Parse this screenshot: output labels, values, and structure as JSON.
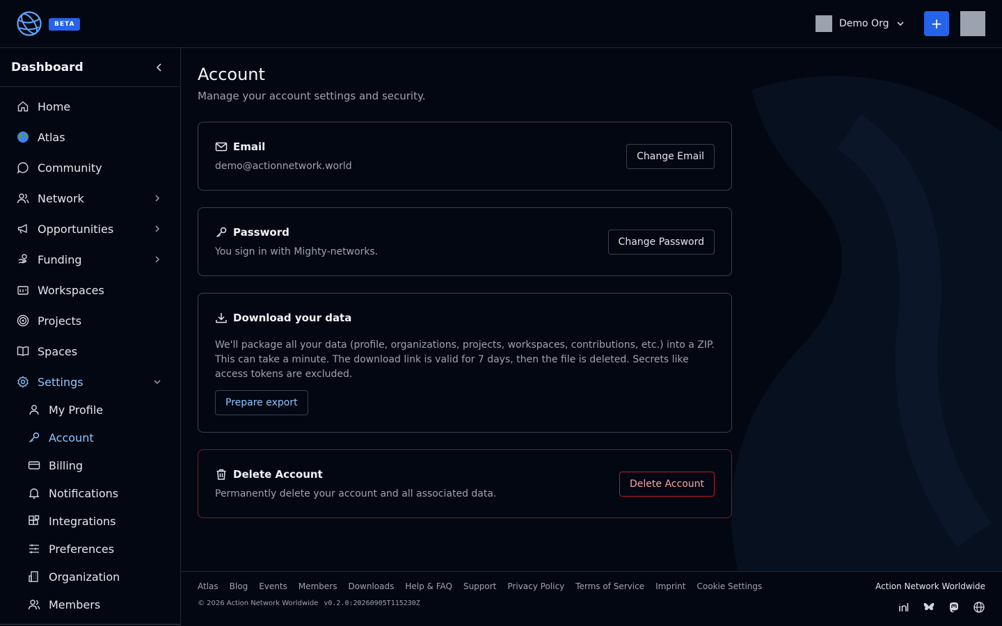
{
  "topbar": {
    "badge": "BETA",
    "org_name": "Demo Org",
    "add_label": "+"
  },
  "sidebar": {
    "title": "Dashboard",
    "items": [
      {
        "label": "Home",
        "icon": "home-icon"
      },
      {
        "label": "Atlas",
        "icon": "globe-icon"
      },
      {
        "label": "Community",
        "icon": "chat-bubble-icon"
      },
      {
        "label": "Network",
        "icon": "users-icon"
      },
      {
        "label": "Opportunities",
        "icon": "megaphone-icon"
      },
      {
        "label": "Funding",
        "icon": "funding-icon"
      },
      {
        "label": "Workspaces",
        "icon": "workspace-icon"
      },
      {
        "label": "Projects",
        "icon": "target-icon"
      },
      {
        "label": "Spaces",
        "icon": "book-open-icon"
      },
      {
        "label": "Settings",
        "icon": "gear-icon"
      }
    ],
    "settings_items": [
      {
        "label": "My Profile",
        "icon": "user-icon"
      },
      {
        "label": "Account",
        "icon": "key-icon"
      },
      {
        "label": "Billing",
        "icon": "credit-card-icon"
      },
      {
        "label": "Notifications",
        "icon": "bell-icon"
      },
      {
        "label": "Integrations",
        "icon": "blocks-icon"
      },
      {
        "label": "Preferences",
        "icon": "sliders-icon"
      },
      {
        "label": "Organization",
        "icon": "building-icon"
      },
      {
        "label": "Members",
        "icon": "users-icon"
      }
    ]
  },
  "main": {
    "title": "Account",
    "subtitle": "Manage your account settings and security.",
    "email": {
      "title": "Email",
      "value": "demo@actionnetwork.world",
      "button": "Change Email"
    },
    "password": {
      "title": "Password",
      "text": "You sign in with Mighty-networks.",
      "button": "Change Password"
    },
    "download": {
      "title": "Download your data",
      "text": "We'll package all your data (profile, organizations, projects, workspaces, contributions, etc.) into a ZIP. This can take a minute. The download link is valid for 7 days, then the file is deleted. Secrets like access tokens are excluded.",
      "button": "Prepare export"
    },
    "delete": {
      "title": "Delete Account",
      "text": "Permanently delete your account and all associated data.",
      "button": "Delete Account"
    }
  },
  "footer": {
    "links": [
      "Atlas",
      "Blog",
      "Events",
      "Members",
      "Downloads",
      "Help & FAQ",
      "Support",
      "Privacy Policy",
      "Terms of Service",
      "Imprint",
      "Cookie Settings"
    ],
    "copyright": "© 2026 Action Network Worldwide",
    "version": "v0.2.0:20260905T115230Z",
    "brand": "Action Network Worldwide",
    "socials": [
      "linkedin-icon",
      "bluesky-icon",
      "mastodon-icon",
      "globe-icon"
    ]
  },
  "colors": {
    "background": "#030712",
    "accent": "#2563eb",
    "active_text": "#93c5fd",
    "danger": "#b91c1c"
  }
}
